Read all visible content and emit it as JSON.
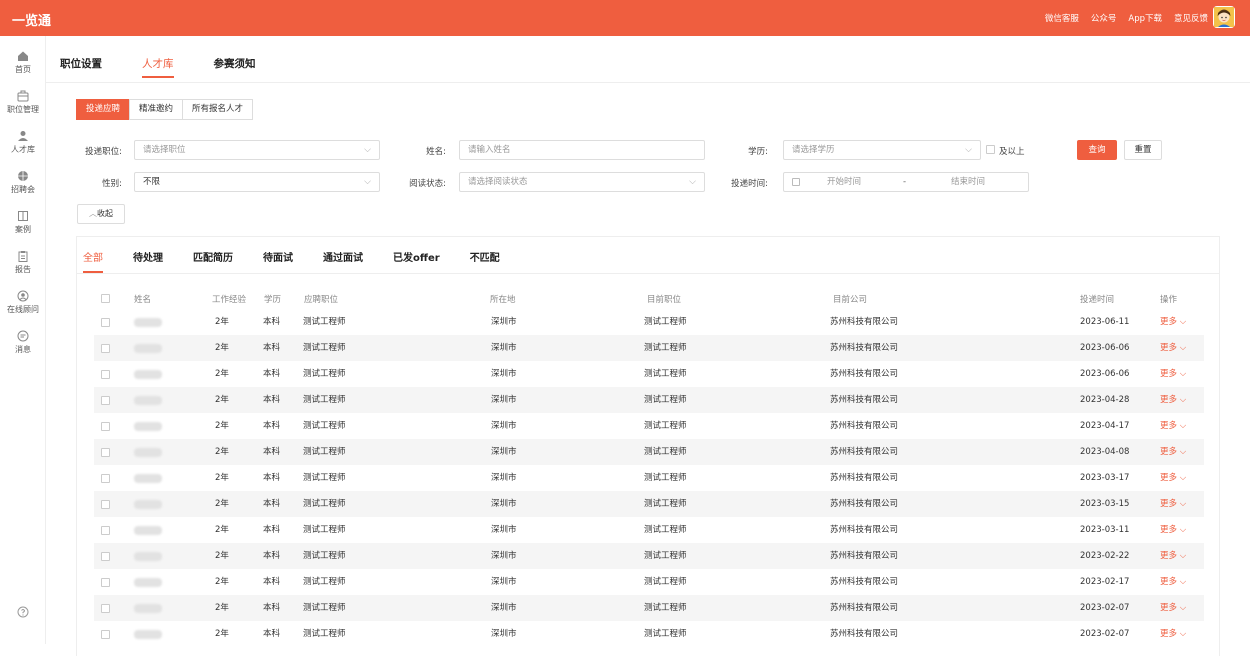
{
  "brand": "一览通",
  "top_links": [
    "微信客服",
    "公众号",
    "App下载",
    "意见反馈"
  ],
  "sidebar": [
    {
      "label": "首页",
      "icon": "home-icon"
    },
    {
      "label": "职位管理",
      "icon": "briefcase-icon"
    },
    {
      "label": "人才库",
      "icon": "person-icon"
    },
    {
      "label": "招聘会",
      "icon": "globe-icon"
    },
    {
      "label": "案例",
      "icon": "book-icon"
    },
    {
      "label": "报告",
      "icon": "clipboard-icon"
    },
    {
      "label": "在线顾问",
      "icon": "headset-icon"
    },
    {
      "label": "消息",
      "icon": "chat-icon"
    }
  ],
  "page_tabs": [
    "职位设置",
    "人才库",
    "参赛须知"
  ],
  "sub_tabs": [
    "投递应聘",
    "精准邀约",
    "所有报名人才"
  ],
  "filters": {
    "position_label": "投递职位:",
    "position_placeholder": "请选择职位",
    "name_label": "姓名:",
    "name_placeholder": "请输入姓名",
    "edu_label": "学历:",
    "edu_placeholder": "请选择学历",
    "above_label": "及以上",
    "gender_label": "性别:",
    "gender_value": "不限",
    "read_label": "阅读状态:",
    "read_placeholder": "请选择阅读状态",
    "time_label": "投递时间:",
    "start_placeholder": "开始时间",
    "range_sep": "-",
    "end_placeholder": "结束时间",
    "search_btn": "查询",
    "reset_btn": "重置",
    "collapse_btn": "收起"
  },
  "status_tabs": [
    "全部",
    "待处理",
    "匹配简历",
    "待面试",
    "通过面试",
    "已发offer",
    "不匹配"
  ],
  "table": {
    "headers": [
      "姓名",
      "工作经验",
      "学历",
      "应聘职位",
      "所在地",
      "目前职位",
      "目前公司",
      "投递时间",
      "操作"
    ],
    "more_label": "更多",
    "rows": [
      {
        "exp": "2年",
        "edu": "本科",
        "job": "测试工程师",
        "city": "深圳市",
        "current": "测试工程师",
        "company": "苏州科技有限公司",
        "date": "2023-06-11"
      },
      {
        "exp": "2年",
        "edu": "本科",
        "job": "测试工程师",
        "city": "深圳市",
        "current": "测试工程师",
        "company": "苏州科技有限公司",
        "date": "2023-06-06"
      },
      {
        "exp": "2年",
        "edu": "本科",
        "job": "测试工程师",
        "city": "深圳市",
        "current": "测试工程师",
        "company": "苏州科技有限公司",
        "date": "2023-06-06"
      },
      {
        "exp": "2年",
        "edu": "本科",
        "job": "测试工程师",
        "city": "深圳市",
        "current": "测试工程师",
        "company": "苏州科技有限公司",
        "date": "2023-04-28"
      },
      {
        "exp": "2年",
        "edu": "本科",
        "job": "测试工程师",
        "city": "深圳市",
        "current": "测试工程师",
        "company": "苏州科技有限公司",
        "date": "2023-04-17"
      },
      {
        "exp": "2年",
        "edu": "本科",
        "job": "测试工程师",
        "city": "深圳市",
        "current": "测试工程师",
        "company": "苏州科技有限公司",
        "date": "2023-04-08"
      },
      {
        "exp": "2年",
        "edu": "本科",
        "job": "测试工程师",
        "city": "深圳市",
        "current": "测试工程师",
        "company": "苏州科技有限公司",
        "date": "2023-03-17"
      },
      {
        "exp": "2年",
        "edu": "本科",
        "job": "测试工程师",
        "city": "深圳市",
        "current": "测试工程师",
        "company": "苏州科技有限公司",
        "date": "2023-03-15"
      },
      {
        "exp": "2年",
        "edu": "本科",
        "job": "测试工程师",
        "city": "深圳市",
        "current": "测试工程师",
        "company": "苏州科技有限公司",
        "date": "2023-03-11"
      },
      {
        "exp": "2年",
        "edu": "本科",
        "job": "测试工程师",
        "city": "深圳市",
        "current": "测试工程师",
        "company": "苏州科技有限公司",
        "date": "2023-02-22"
      },
      {
        "exp": "2年",
        "edu": "本科",
        "job": "测试工程师",
        "city": "深圳市",
        "current": "测试工程师",
        "company": "苏州科技有限公司",
        "date": "2023-02-17"
      },
      {
        "exp": "2年",
        "edu": "本科",
        "job": "测试工程师",
        "city": "深圳市",
        "current": "测试工程师",
        "company": "苏州科技有限公司",
        "date": "2023-02-07"
      },
      {
        "exp": "2年",
        "edu": "本科",
        "job": "测试工程师",
        "city": "深圳市",
        "current": "测试工程师",
        "company": "苏州科技有限公司",
        "date": "2023-02-07"
      }
    ]
  },
  "colors": {
    "accent": "#ef5e3f"
  }
}
